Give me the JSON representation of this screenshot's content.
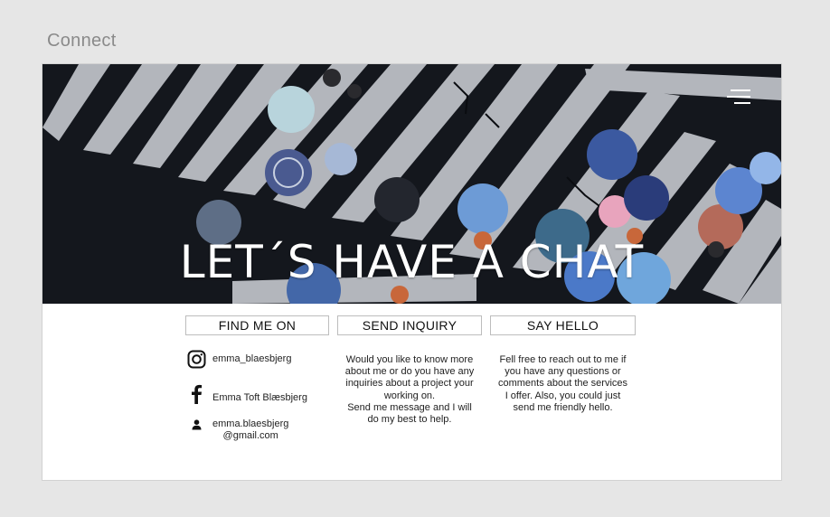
{
  "artboard": {
    "label": "Connect"
  },
  "hero": {
    "title": "LET´S HAVE A CHAT",
    "menu_icon": "hamburger-menu-icon",
    "image_description_colors": {
      "asphalt": "#111419",
      "stripe": "#d9dbe0",
      "umbrella_blue": "#4a6fb0",
      "umbrella_pink": "#e8a0b8",
      "umbrella_light_blue": "#7ab0e0"
    }
  },
  "sections": {
    "find_me_on": {
      "header": "FIND ME ON",
      "items": [
        {
          "icon": "instagram-icon",
          "text": "emma_blaesbjerg"
        },
        {
          "icon": "facebook-icon",
          "text": "Emma Toft Blæsbjerg"
        },
        {
          "icon": "person-icon",
          "text_line1": "emma.blaesbjerg",
          "text_line2": "@gmail.com"
        }
      ]
    },
    "send_inquiry": {
      "header": "SEND INQUIRY",
      "body": "Would you like to know more\nabout me or do you have any\ninquiries about a project your\nworking on.\nSend me message and I will\ndo my best to help."
    },
    "say_hello": {
      "header": "SAY HELLO",
      "body": "Fell free to reach out to me if\nyou have any questions or\ncomments about the services\nI offer. Also, you could just\nsend me friendly hello."
    }
  }
}
